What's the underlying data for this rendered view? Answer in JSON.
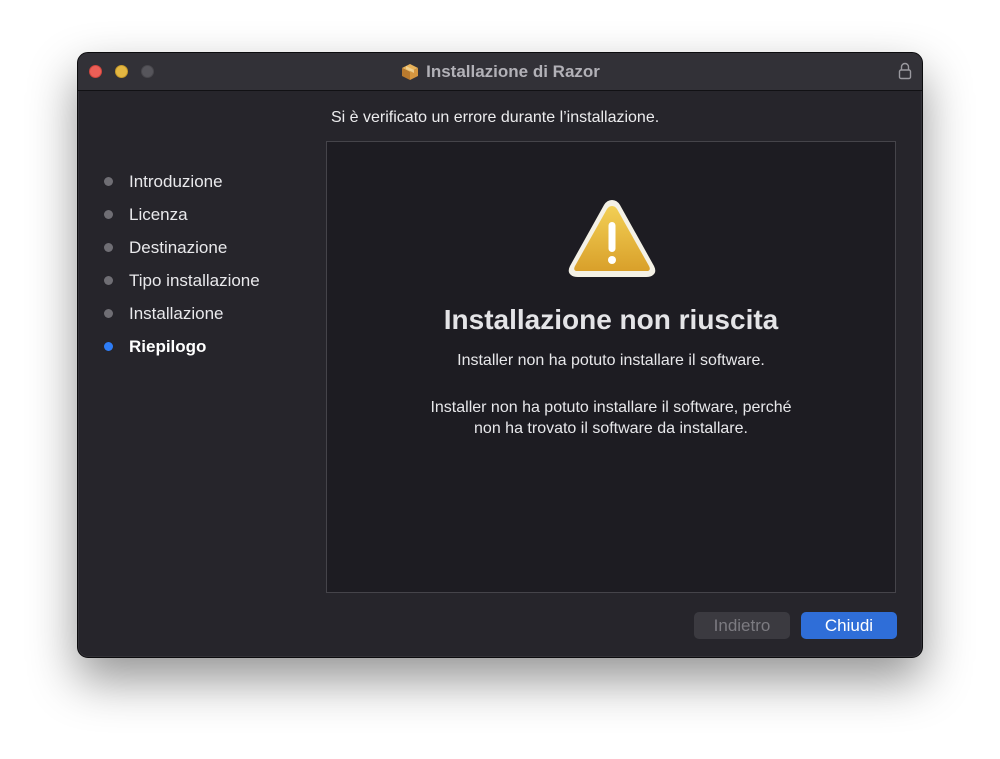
{
  "window": {
    "title": "Installazione di Razor",
    "icons": {
      "package": "package-icon",
      "lock": "lock-icon",
      "warning": "warning-icon"
    }
  },
  "header": {
    "text": "Si è verificato un errore durante l’installazione."
  },
  "sidebar": {
    "items": [
      {
        "label": "Introduzione",
        "active": false
      },
      {
        "label": "Licenza",
        "active": false
      },
      {
        "label": "Destinazione",
        "active": false
      },
      {
        "label": "Tipo installazione",
        "active": false
      },
      {
        "label": "Installazione",
        "active": false
      },
      {
        "label": "Riepilogo",
        "active": true
      }
    ]
  },
  "content": {
    "title": "Installazione non riuscita",
    "subtitle": "Installer non ha potuto installare il software.",
    "detail_line1": "Installer non ha potuto installare il software, perché",
    "detail_line2": "non ha trovato il software da installare."
  },
  "buttons": {
    "back_label": "Indietro",
    "back_enabled": false,
    "close_label": "Chiudi"
  },
  "colors": {
    "accent": "#2e7df6",
    "warning": "#e6b93a"
  }
}
